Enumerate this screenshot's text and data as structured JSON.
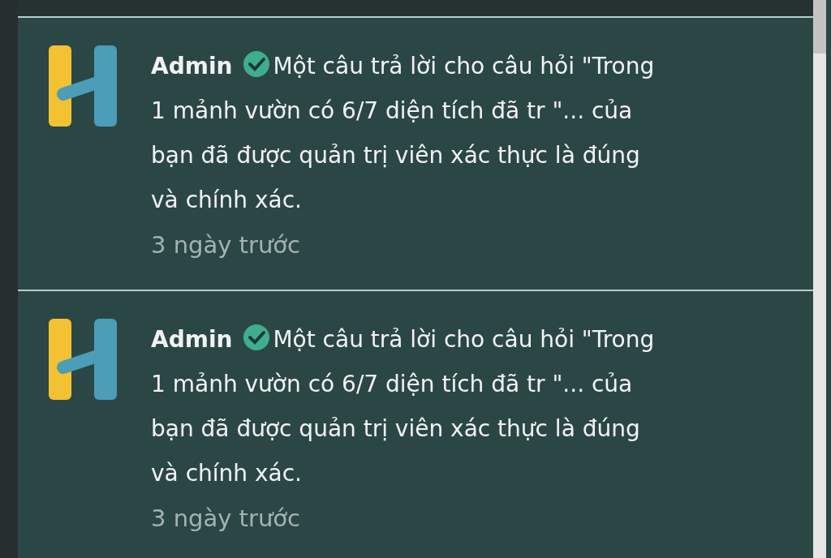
{
  "notifications": [
    {
      "author": "Admin",
      "verified": true,
      "message_lines": [
        "Một câu trả lời cho câu hỏi \"Trong",
        "1 mảnh vườn có 6/7 diện tích đã tr \"... của",
        "bạn đã được quản trị viên xác thực là đúng",
        "và chính xác."
      ],
      "time": "3 ngày trước"
    },
    {
      "author": "Admin",
      "verified": true,
      "message_lines": [
        "Một câu trả lời cho câu hỏi \"Trong",
        "1 mảnh vườn có 6/7 diện tích đã tr \"... của",
        "bạn đã được quản trị viên xác thực là đúng",
        "và chính xác."
      ],
      "time": "3 ngày trước"
    }
  ]
}
